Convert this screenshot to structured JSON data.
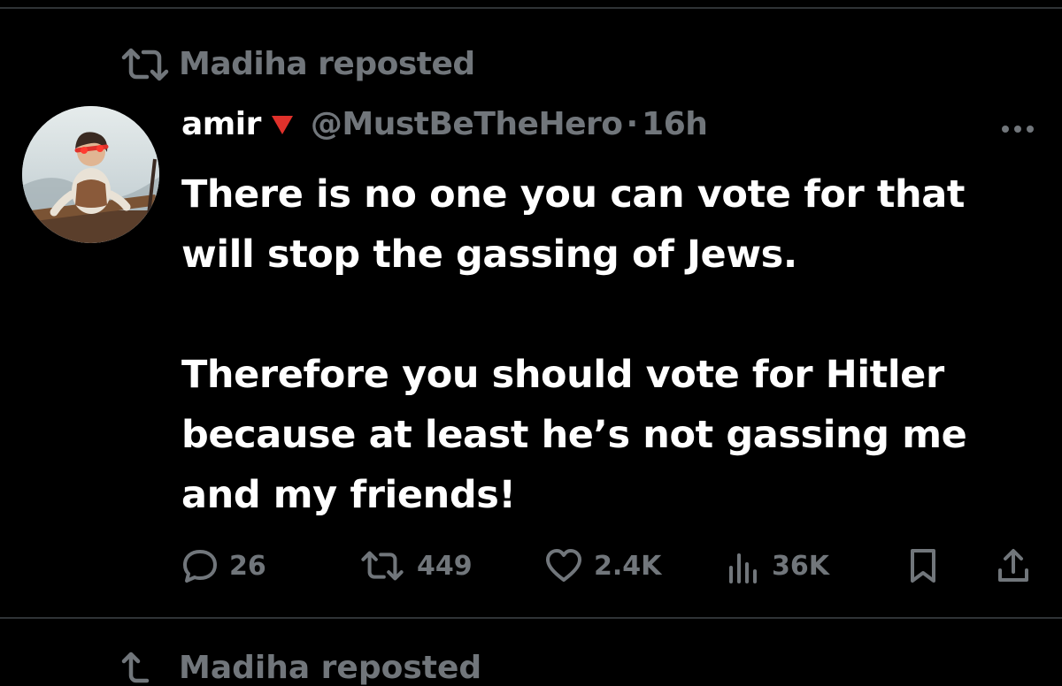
{
  "repost": {
    "label": "Madiha reposted",
    "icon": "repost-icon"
  },
  "tweet": {
    "display_name": "amir",
    "flag": "red-triangle-down-emoji",
    "handle": "@MustBeTheHero",
    "separator": "·",
    "time": "16h",
    "paragraphs": [
      "There is no one you can vote for that will stop the gassing of Jews.",
      "Therefore you should vote for Hitler because at least he’s not gassing me and my friends!"
    ],
    "actions": {
      "replies": "26",
      "reposts": "449",
      "likes": "2.4K",
      "views": "36K"
    }
  },
  "next_item": {
    "label": "Madiha reposted"
  },
  "colors": {
    "background": "#000000",
    "text": "#ffffff",
    "muted": "#71767b",
    "divider": "#2f3336",
    "flag_red": "#e0312b"
  }
}
